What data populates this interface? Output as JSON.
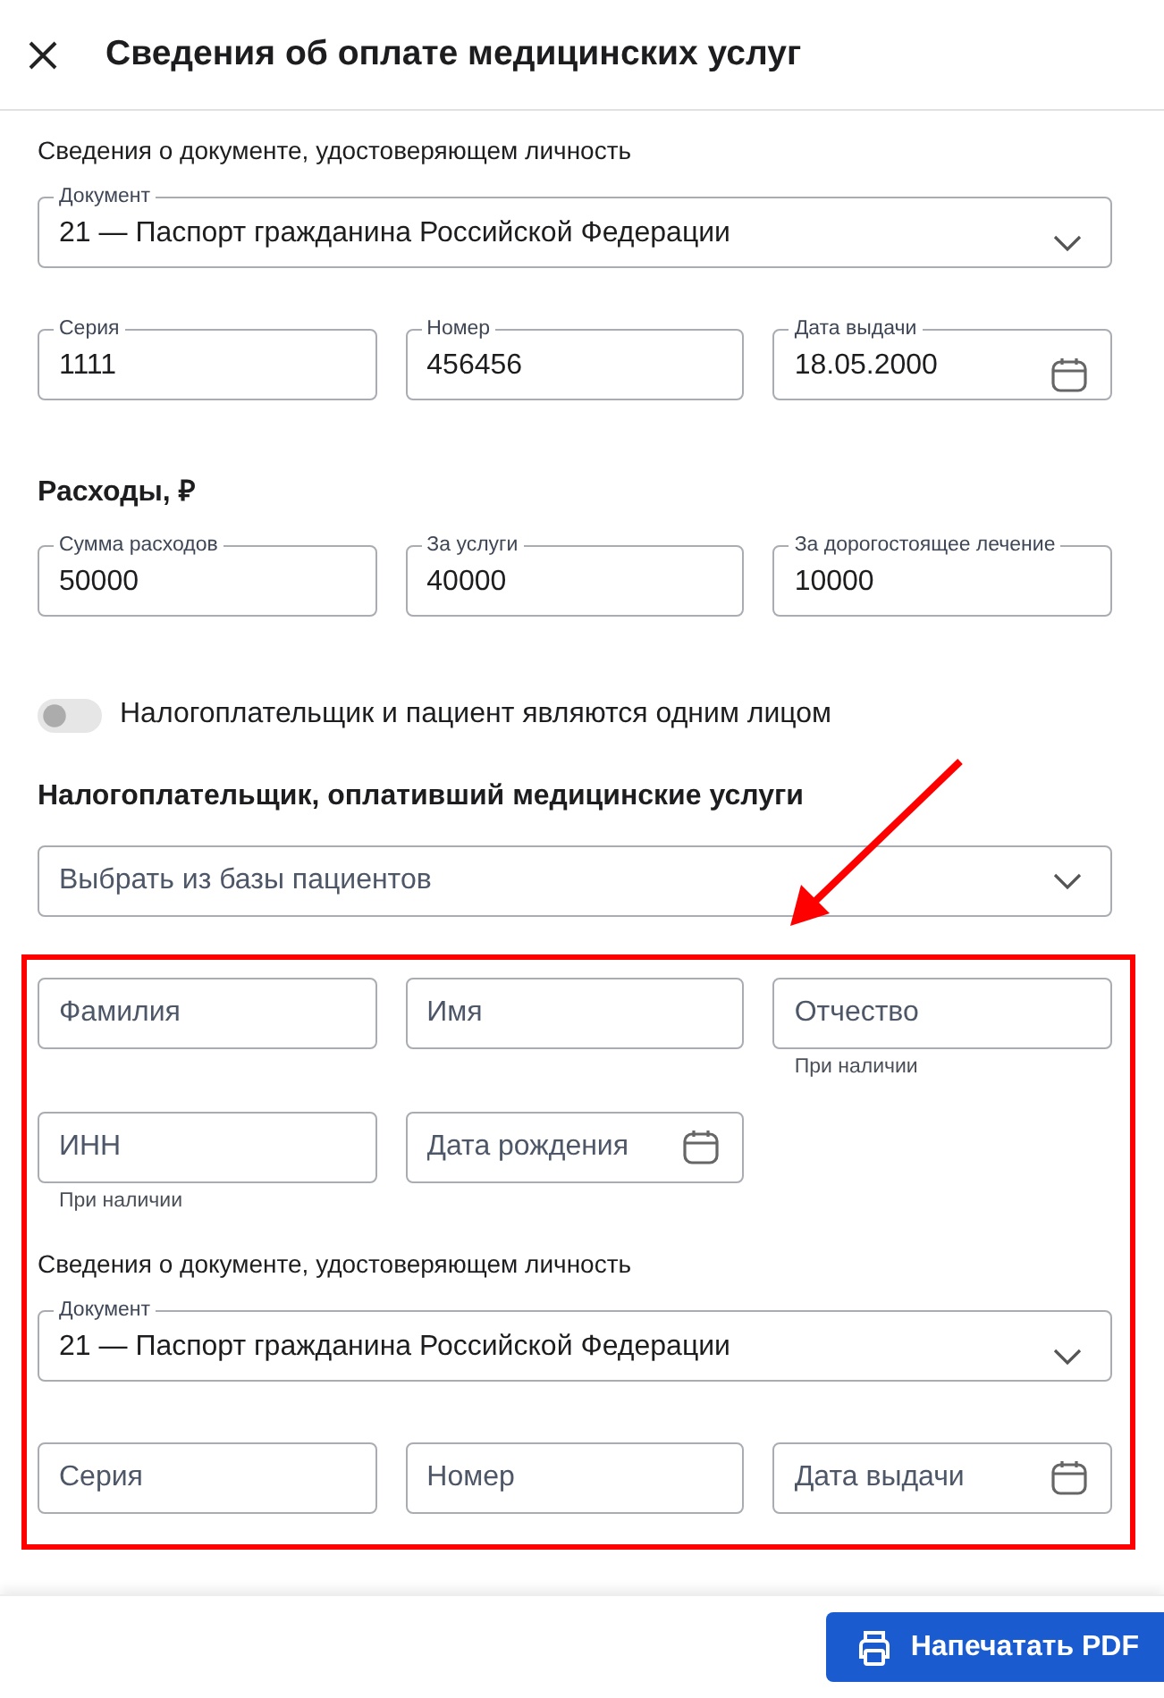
{
  "header": {
    "title": "Сведения об оплате медицинских услуг"
  },
  "patient_document": {
    "section_label": "Сведения о документе, удостоверяющем личность",
    "document": {
      "label": "Документ",
      "value": "21 — Паспорт гражданина Российской Федерации"
    },
    "fields": [
      {
        "kind": "text",
        "label": "Серия",
        "value": "1111"
      },
      {
        "kind": "text",
        "label": "Номер",
        "value": "456456"
      },
      {
        "kind": "date",
        "label": "Дата выдачи",
        "value": "18.05.2000"
      }
    ]
  },
  "expenses": {
    "title": "Расходы, ₽",
    "fields": [
      {
        "kind": "text",
        "label": "Сумма расходов",
        "value": "50000"
      },
      {
        "kind": "text",
        "label": "За услуги",
        "value": "40000"
      },
      {
        "kind": "text",
        "label": "За дорогостоящее лечение",
        "value": "10000"
      }
    ]
  },
  "same_person_toggle": {
    "label": "Налогоплательщик и пациент являются одним лицом",
    "on": false
  },
  "taxpayer": {
    "title": "Налогоплательщик, оплативший медицинские услуги",
    "select": {
      "placeholder": "Выбрать из базы пациентов"
    },
    "fields": [
      {
        "kind": "text",
        "placeholder": "Фамилия"
      },
      {
        "kind": "text",
        "placeholder": "Имя"
      },
      {
        "kind": "text",
        "placeholder": "Отчество",
        "hint": "При наличии"
      },
      {
        "kind": "text",
        "placeholder": "ИНН",
        "hint": "При наличии"
      },
      {
        "kind": "date",
        "placeholder": "Дата рождения"
      }
    ],
    "document_section_label": "Сведения о документе, удостоверяющем личность",
    "document": {
      "label": "Документ",
      "value": "21 — Паспорт гражданина Российской Федерации"
    },
    "document_fields": [
      {
        "kind": "text",
        "placeholder": "Серия"
      },
      {
        "kind": "text",
        "placeholder": "Номер"
      },
      {
        "kind": "date",
        "placeholder": "Дата выдачи"
      }
    ]
  },
  "footer": {
    "print_button": "Напечатать PDF"
  }
}
